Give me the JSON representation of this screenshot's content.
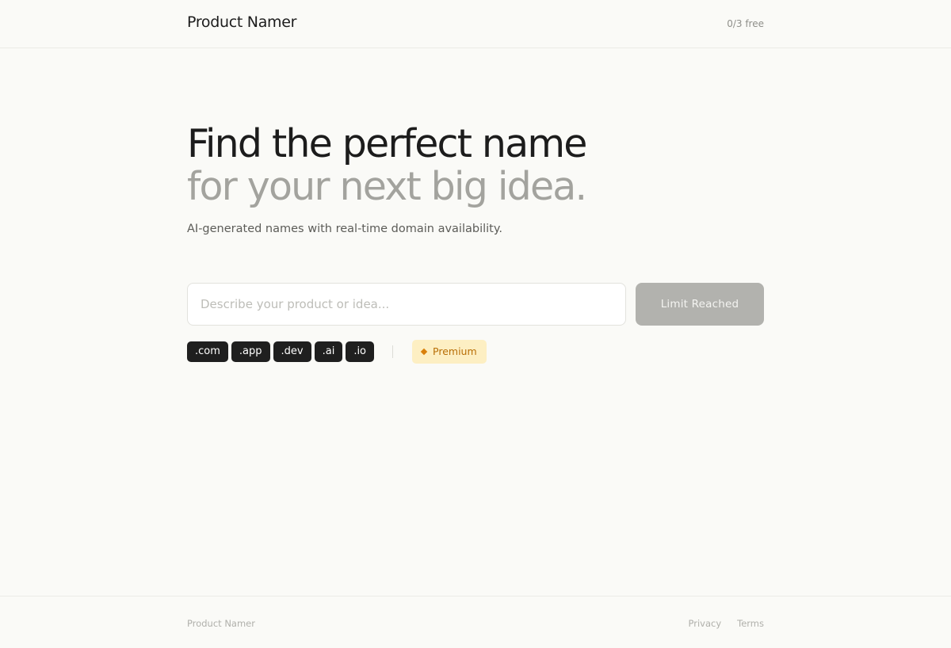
{
  "header": {
    "brand": "Product Namer",
    "quota": "0/3 free"
  },
  "hero": {
    "title_line1": "Find the perfect name",
    "title_line2": "for your next big idea.",
    "subtitle": "AI-generated names with real-time domain availability."
  },
  "search": {
    "placeholder": "Describe your product or idea...",
    "value": "",
    "button_label": "Limit Reached"
  },
  "tlds": [
    ".com",
    ".app",
    ".dev",
    ".ai",
    ".io"
  ],
  "premium": {
    "label": "Premium",
    "icon": "diamond-icon"
  },
  "footer": {
    "brand": "Product Namer",
    "links": [
      "Privacy",
      "Terms"
    ]
  },
  "colors": {
    "background": "#fafaf7",
    "chip": "#1f1f1f",
    "button_disabled": "#b2b2ae",
    "premium_bg": "#fdefc3",
    "premium_text": "#b86e06"
  }
}
